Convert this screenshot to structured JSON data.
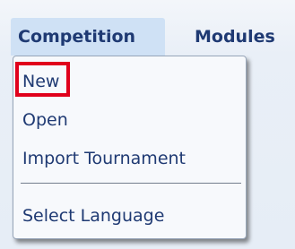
{
  "menubar": {
    "items": [
      {
        "label": "Competition"
      },
      {
        "label": "Modules"
      }
    ]
  },
  "dropdown": {
    "items": [
      {
        "label": "New"
      },
      {
        "label": "Open"
      },
      {
        "label": "Import Tournament"
      },
      {
        "label": "Select Language"
      }
    ]
  },
  "colors": {
    "menu_text": "#1f3a73",
    "active_menu_bg": "#cfe1f5",
    "highlight_border": "#e0001b"
  }
}
